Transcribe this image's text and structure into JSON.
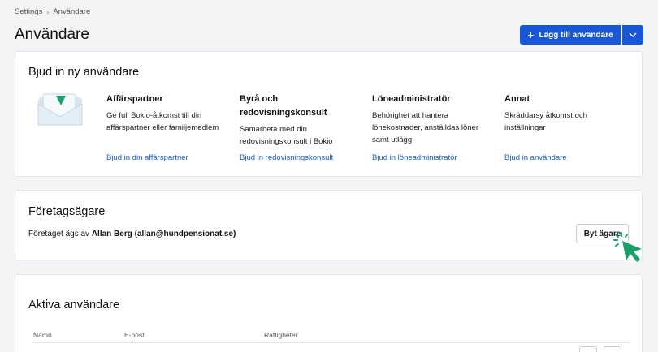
{
  "breadcrumb": {
    "parent": "Settings",
    "separator": "›",
    "current": "Användare"
  },
  "page_title": "Användare",
  "add_button": {
    "label": "Lägg till användare",
    "icon": "plus-icon"
  },
  "invite": {
    "title": "Bjud in ny användare",
    "columns": [
      {
        "title": "Affärspartner",
        "desc": "Ge full Bokio-åtkomst till din affärspartner eller familjemedlem",
        "link": "Bjud in din affärspartner"
      },
      {
        "title": "Byrå och redovisningskonsult",
        "desc": "Samarbeta med din redovisningskonsult i Bokio",
        "link": "Bjud in redovisningskonsult"
      },
      {
        "title": "Löneadministratör",
        "desc": "Behörighet att hantera lönekostnader, anställdas löner samt utlägg",
        "link": "Bjud in löneadministratör"
      },
      {
        "title": "Annat",
        "desc": "Skräddarsy åtkomst och inställningar",
        "link": "Bjud in användare"
      }
    ]
  },
  "owner": {
    "title": "Företagsägare",
    "text_prefix": "Företaget ägs av ",
    "owner_name": "Allan Berg (allan@hundpensionat.se)",
    "change_button": "Byt ägare"
  },
  "active_users": {
    "title": "Aktiva användare",
    "columns": [
      "Namn",
      "E-post",
      "Rättigheter"
    ]
  },
  "colors": {
    "accent": "#1857d8",
    "cursor": "#1aa06b",
    "background": "#f3f4f6"
  }
}
